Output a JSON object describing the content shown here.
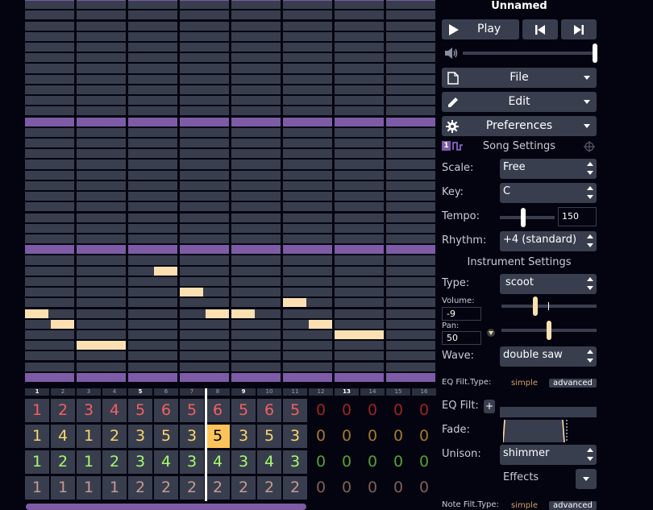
{
  "song": {
    "title": "Unnamed"
  },
  "transport": {
    "play_label": "Play"
  },
  "menus": {
    "file_label": "File",
    "edit_label": "Edit",
    "prefs_label": "Preferences"
  },
  "song_settings": {
    "heading": "Song Settings",
    "channel_badge": "1",
    "scale_label": "Scale:",
    "scale_value": "Free",
    "key_label": "Key:",
    "key_value": "C",
    "tempo_label": "Tempo:",
    "tempo_value": "150",
    "rhythm_label": "Rhythm:",
    "rhythm_value": "+4 (standard)"
  },
  "instrument_settings": {
    "heading": "Instrument Settings",
    "type_label": "Type:",
    "type_value": "scoot",
    "volume_label": "Volume:",
    "volume_value": "-9",
    "pan_label": "Pan:",
    "pan_value": "50",
    "wave_label": "Wave:",
    "wave_value": "double saw",
    "eq_filt_type_label": "EQ Filt.Type:",
    "simple_label": "simple",
    "advanced_label": "advanced",
    "eq_filt_label": "EQ Filt:",
    "plus_label": "+",
    "fade_label": "Fade:",
    "unison_label": "Unison:",
    "unison_value": "shimmer",
    "effects_label": "Effects",
    "note_filt_type_label": "Note Filt.Type:"
  },
  "sliders": {
    "master_volume": 1.0,
    "tempo": 0.43,
    "volume": 0.36,
    "pan": 0.5
  },
  "colors": {
    "track1": "#f55f5f",
    "track1_dim": "#9b2424",
    "track2": "#fbd66a",
    "track2_dim": "#a5782c",
    "track3": "#a6fa6b",
    "track3_dim": "#54a134",
    "track4": "#c69a8e",
    "track4_dim": "#7f5f57",
    "selected_cell": "#fbc35a",
    "note": "#fde0b2",
    "octave": "#7e5ba6"
  },
  "bar_numbers": [
    "1",
    "2",
    "3",
    "4",
    "5",
    "6",
    "7",
    "8",
    "9",
    "10",
    "11",
    "12",
    "13",
    "14",
    "15",
    "16"
  ],
  "highlighted_bars": [
    0,
    4,
    8,
    12
  ],
  "playhead_bar": 7.0,
  "tracks": [
    [
      "1",
      "2",
      "3",
      "4",
      "5",
      "6",
      "5",
      "6",
      "5",
      "6",
      "5",
      "0",
      "0",
      "0",
      "0",
      "0"
    ],
    [
      "1",
      "4",
      "1",
      "2",
      "3",
      "5",
      "3",
      "5",
      "3",
      "5",
      "3",
      "0",
      "0",
      "0",
      "0",
      "0"
    ],
    [
      "1",
      "2",
      "1",
      "2",
      "3",
      "4",
      "3",
      "4",
      "3",
      "4",
      "3",
      "0",
      "0",
      "0",
      "0",
      "0"
    ],
    [
      "1",
      "1",
      "1",
      "1",
      "2",
      "2",
      "2",
      "2",
      "2",
      "2",
      "2",
      "0",
      "0",
      "0",
      "0",
      "0"
    ]
  ],
  "selected_cell": {
    "track": 1,
    "bar": 7
  },
  "visible_bars": 8,
  "pitch_rows": 36,
  "octave_rows": [
    0,
    12,
    24,
    36
  ],
  "notes": [
    {
      "bar": 0,
      "start": 0.0,
      "end": 0.5,
      "pitch": 6
    },
    {
      "bar": 0,
      "start": 0.5,
      "end": 1.0,
      "pitch": 5
    },
    {
      "bar": 1,
      "start": 0.0,
      "end": 1.0,
      "pitch": 3
    },
    {
      "bar": 2,
      "start": 0.5,
      "end": 1.0,
      "pitch": 10
    },
    {
      "bar": 3,
      "start": 0.0,
      "end": 0.5,
      "pitch": 8
    },
    {
      "bar": 3,
      "start": 0.5,
      "end": 1.0,
      "pitch": 6
    },
    {
      "bar": 4,
      "start": 0.0,
      "end": 0.5,
      "pitch": 6
    },
    {
      "bar": 5,
      "start": 0.0,
      "end": 0.5,
      "pitch": 7
    },
    {
      "bar": 5,
      "start": 0.5,
      "end": 1.0,
      "pitch": 5
    },
    {
      "bar": 6,
      "start": 0.0,
      "end": 1.0,
      "pitch": 4
    }
  ],
  "icons": {
    "play": "play-triangle-icon",
    "prev": "skip-back-icon",
    "next": "skip-forward-icon",
    "volume": "speaker-icon",
    "file": "document-icon",
    "edit": "pencil-icon",
    "prefs": "gear-icon",
    "wave": "pulse-wave-icon",
    "target": "crosshair-icon"
  }
}
